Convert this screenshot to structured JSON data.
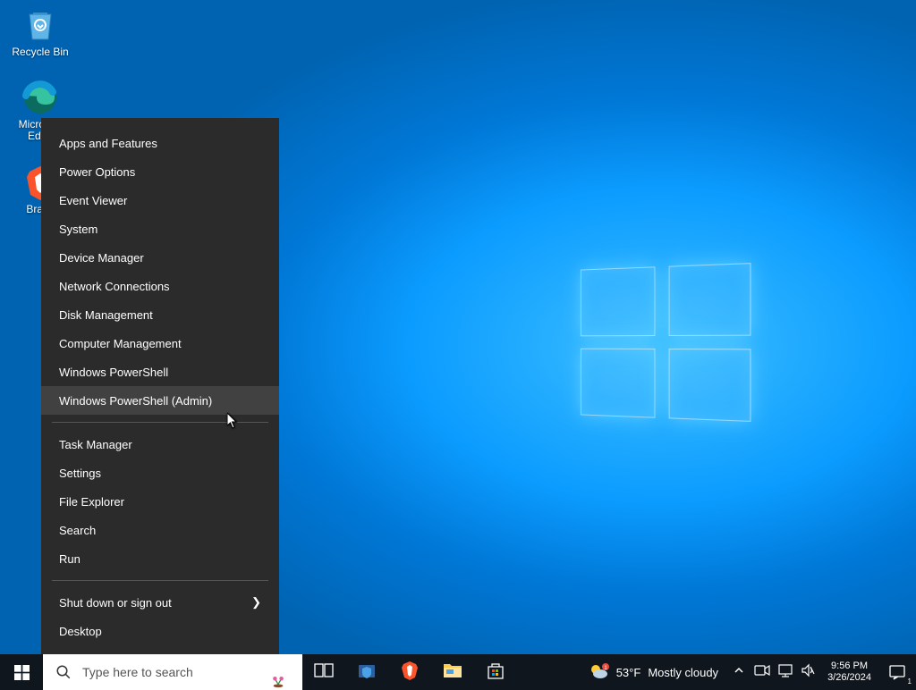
{
  "desktop": {
    "icons": [
      {
        "label": "Recycle Bin",
        "icon": "recycle-bin-icon"
      },
      {
        "label": "Microsoft Edge",
        "icon": "edge-icon"
      },
      {
        "label": "Brave",
        "icon": "brave-icon"
      }
    ]
  },
  "winx_menu": {
    "items": [
      {
        "label": "Apps and Features",
        "sep_after": false,
        "hover": false,
        "submenu": false
      },
      {
        "label": "Power Options",
        "sep_after": false,
        "hover": false,
        "submenu": false
      },
      {
        "label": "Event Viewer",
        "sep_after": false,
        "hover": false,
        "submenu": false
      },
      {
        "label": "System",
        "sep_after": false,
        "hover": false,
        "submenu": false
      },
      {
        "label": "Device Manager",
        "sep_after": false,
        "hover": false,
        "submenu": false
      },
      {
        "label": "Network Connections",
        "sep_after": false,
        "hover": false,
        "submenu": false
      },
      {
        "label": "Disk Management",
        "sep_after": false,
        "hover": false,
        "submenu": false
      },
      {
        "label": "Computer Management",
        "sep_after": false,
        "hover": false,
        "submenu": false
      },
      {
        "label": "Windows PowerShell",
        "sep_after": false,
        "hover": false,
        "submenu": false
      },
      {
        "label": "Windows PowerShell (Admin)",
        "sep_after": true,
        "hover": true,
        "submenu": false
      },
      {
        "label": "Task Manager",
        "sep_after": false,
        "hover": false,
        "submenu": false
      },
      {
        "label": "Settings",
        "sep_after": false,
        "hover": false,
        "submenu": false
      },
      {
        "label": "File Explorer",
        "sep_after": false,
        "hover": false,
        "submenu": false
      },
      {
        "label": "Search",
        "sep_after": false,
        "hover": false,
        "submenu": false
      },
      {
        "label": "Run",
        "sep_after": true,
        "hover": false,
        "submenu": false
      },
      {
        "label": "Shut down or sign out",
        "sep_after": false,
        "hover": false,
        "submenu": true
      },
      {
        "label": "Desktop",
        "sep_after": false,
        "hover": false,
        "submenu": false
      }
    ]
  },
  "taskbar": {
    "search_placeholder": "Type here to search",
    "pinned": [
      {
        "name": "task-view-icon"
      },
      {
        "name": "security-icon"
      },
      {
        "name": "brave-taskbar-icon"
      },
      {
        "name": "file-explorer-icon"
      },
      {
        "name": "microsoft-store-icon"
      }
    ],
    "weather": {
      "temp": "53°F",
      "text": "Mostly cloudy"
    },
    "tray": [
      {
        "name": "chevron-up-icon"
      },
      {
        "name": "meet-now-icon"
      },
      {
        "name": "network-icon"
      },
      {
        "name": "volume-icon"
      }
    ],
    "clock": {
      "time": "9:56 PM",
      "date": "3/26/2024"
    },
    "notification_count": "1"
  }
}
